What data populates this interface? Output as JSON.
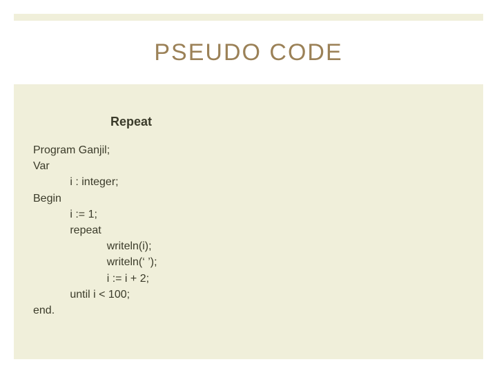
{
  "title": "PSEUDO CODE",
  "subtitle": "Repeat",
  "code": "Program Ganjil;\nVar\n            i : integer;\nBegin\n            i := 1;\n            repeat\n                        writeln(i);\n                        writeln(‘ ’);\n                        i := i + 2;\n            until i < 100;\nend."
}
